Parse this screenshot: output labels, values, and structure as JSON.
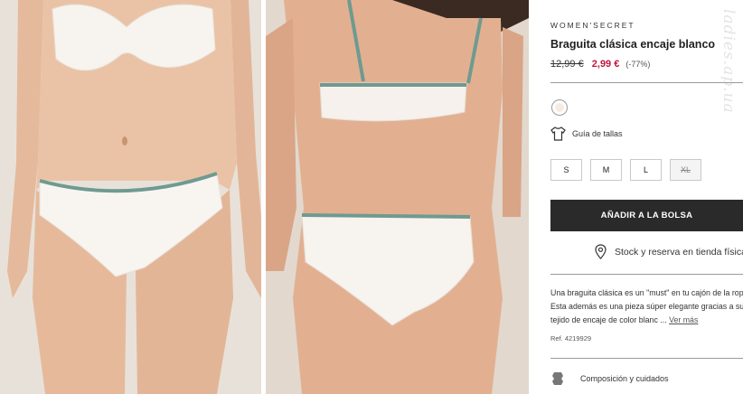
{
  "images": {
    "front": {
      "alt": "front view"
    },
    "back": {
      "alt": "back view"
    }
  },
  "watermark": "ladies.ap.ua",
  "product": {
    "brand": "WOMEN'SECRET",
    "title": "Braguita clásica encaje blanco",
    "price_old": "12,99 €",
    "price_new": "2,99 €",
    "discount": "(-77%)",
    "color_swatch": "#f6ebe2"
  },
  "size_guide": {
    "label": "Guía de tallas",
    "icon": "tshirt-icon"
  },
  "sizes": [
    {
      "label": "S",
      "available": true
    },
    {
      "label": "M",
      "available": true
    },
    {
      "label": "L",
      "available": true
    },
    {
      "label": "XL",
      "available": false
    }
  ],
  "actions": {
    "add_to_bag": "AÑADIR A LA BOLSA",
    "stock_label": "Stock y reserva en tienda física"
  },
  "description": {
    "line1": "Una braguita clásica es un \"must\" en tu cajón de la ropa",
    "line2": "Esta además es una pieza súper elegante gracias a su",
    "line3": "tejido de encaje de color blanc ...",
    "more": "Ver más",
    "ref": "Ref. 4219929"
  },
  "composition": {
    "label": "Composición y cuidados",
    "icon": "label-icon"
  },
  "colors": {
    "button": "#2a2a2a",
    "sale": "#c0183c",
    "trim": "#6f9a91"
  }
}
